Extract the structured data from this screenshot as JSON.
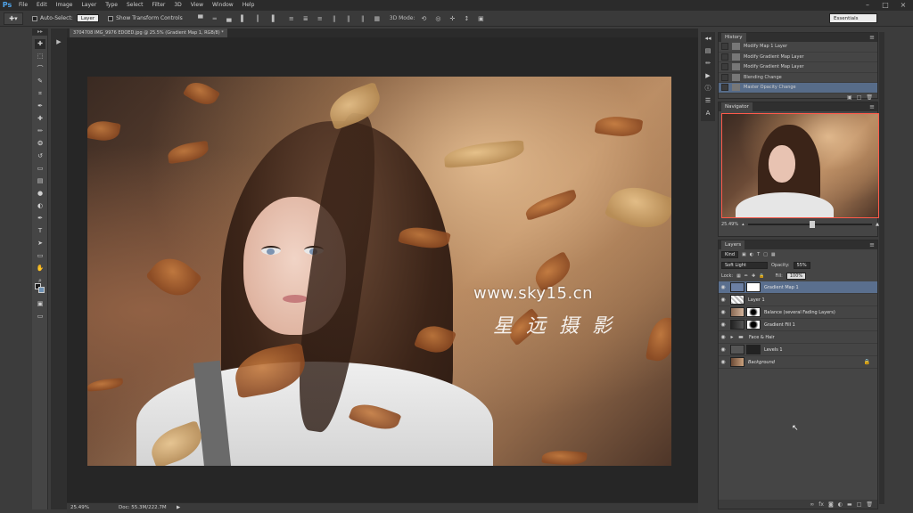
{
  "menubar": {
    "logo": "Ps",
    "items": [
      "File",
      "Edit",
      "Image",
      "Layer",
      "Type",
      "Select",
      "Filter",
      "3D",
      "View",
      "Window",
      "Help"
    ],
    "window_controls": [
      "–",
      "□",
      "×"
    ]
  },
  "options_bar": {
    "auto_select_label": "Auto-Select:",
    "auto_select_value": "Layer",
    "show_transform_label": "Show Transform Controls",
    "mode_3d_label": "3D Mode:",
    "workspace": "Essentials"
  },
  "document": {
    "tab_title": "3704708 IMG_9976 EDOED.jpg @ 25.5% (Gradient Map 1, RGB/8) *",
    "zoom": "25.49%",
    "doc_size": "Doc: 55.3M/222.7M"
  },
  "watermark": {
    "url": "www.sky15.cn",
    "cn": "星 远 摄 影"
  },
  "history_panel": {
    "title": "History",
    "items": [
      {
        "label": "Modify Map 1 Layer",
        "selected": false
      },
      {
        "label": "Modify Gradient Map Layer",
        "selected": false
      },
      {
        "label": "Modify Gradient Map Layer",
        "selected": false
      },
      {
        "label": "Blending Change",
        "selected": false
      },
      {
        "label": "Master Opacity Change",
        "selected": true
      }
    ]
  },
  "navigator_panel": {
    "title": "Navigator",
    "zoom": "25.49%"
  },
  "layers_panel": {
    "title": "Layers",
    "kind": "Kind",
    "blend_mode": "Soft Light",
    "opacity_label": "Opacity:",
    "opacity": "55%",
    "lock_label": "Lock:",
    "fill_label": "Fill:",
    "fill": "100%",
    "layers": [
      {
        "name": "Gradient Map 1",
        "selected": true
      },
      {
        "name": "Layer 1",
        "selected": false
      },
      {
        "name": "Balance (several Fading Layers)",
        "selected": false
      },
      {
        "name": "Gradient Fill 1",
        "selected": false
      },
      {
        "name": "Face & Hair",
        "selected": false,
        "group": true
      },
      {
        "name": "Levels 1",
        "selected": false
      },
      {
        "name": "Background",
        "selected": false,
        "locked": true
      }
    ]
  },
  "colors": {
    "accent": "#576c89",
    "nav_frame": "#ff5a4a"
  }
}
